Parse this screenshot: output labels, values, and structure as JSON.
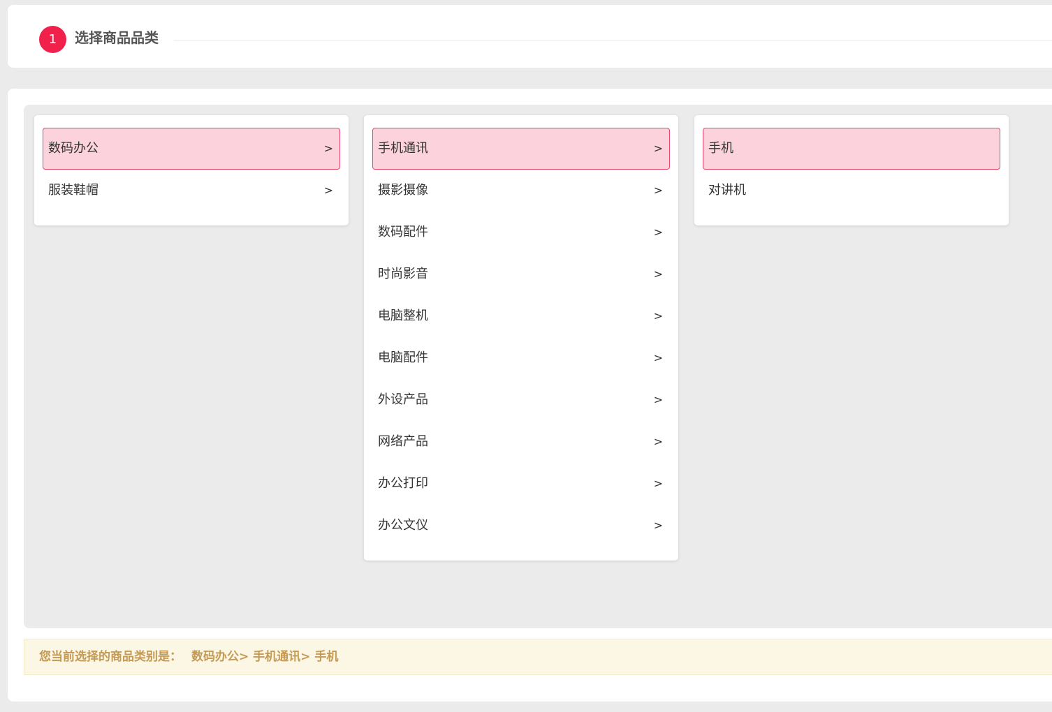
{
  "step": {
    "number": "1",
    "title": "选择商品品类"
  },
  "columns": [
    {
      "items": [
        {
          "label": "数码办公",
          "selected": true,
          "has_children": true
        },
        {
          "label": "服装鞋帽",
          "selected": false,
          "has_children": true
        }
      ]
    },
    {
      "items": [
        {
          "label": "手机通讯",
          "selected": true,
          "has_children": true
        },
        {
          "label": "摄影摄像",
          "selected": false,
          "has_children": true
        },
        {
          "label": "数码配件",
          "selected": false,
          "has_children": true
        },
        {
          "label": "时尚影音",
          "selected": false,
          "has_children": true
        },
        {
          "label": "电脑整机",
          "selected": false,
          "has_children": true
        },
        {
          "label": "电脑配件",
          "selected": false,
          "has_children": true
        },
        {
          "label": "外设产品",
          "selected": false,
          "has_children": true
        },
        {
          "label": "网络产品",
          "selected": false,
          "has_children": true
        },
        {
          "label": "办公打印",
          "selected": false,
          "has_children": true
        },
        {
          "label": "办公文仪",
          "selected": false,
          "has_children": true
        }
      ]
    },
    {
      "items": [
        {
          "label": "手机",
          "selected": true,
          "has_children": false
        },
        {
          "label": "对讲机",
          "selected": false,
          "has_children": false
        }
      ]
    }
  ],
  "arrow_glyph": ">",
  "result": {
    "label": "您当前选择的商品类别是：",
    "path": "数码办公> 手机通讯> 手机"
  },
  "colors": {
    "accent": "#f0214a",
    "selected_bg": "#fcd2dc",
    "selected_border": "#e8456a",
    "result_text": "#c49a54",
    "result_bg": "#fcf6e4"
  }
}
